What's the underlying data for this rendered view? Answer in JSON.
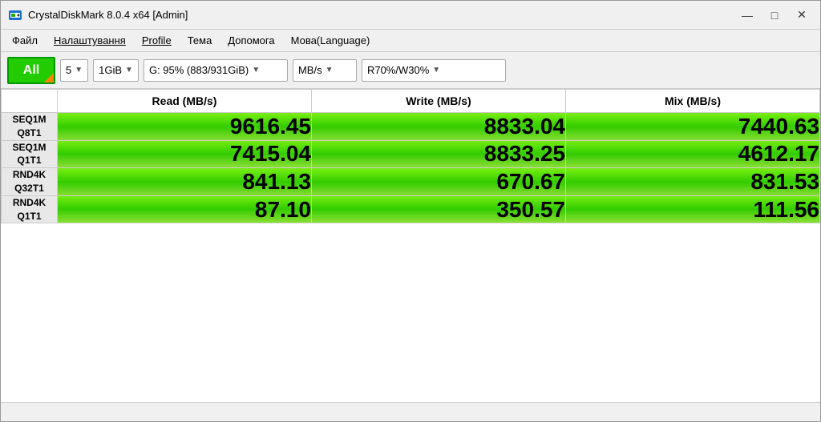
{
  "titlebar": {
    "title": "CrystalDiskMark 8.0.4 x64 [Admin]",
    "controls": {
      "minimize": "—",
      "maximize": "□",
      "close": "✕"
    }
  },
  "menubar": {
    "items": [
      {
        "id": "file",
        "label": "Файл",
        "underline": false
      },
      {
        "id": "settings",
        "label": "Налаштування",
        "underline": true
      },
      {
        "id": "profile",
        "label": "Profile",
        "underline": true
      },
      {
        "id": "theme",
        "label": "Тема",
        "underline": false
      },
      {
        "id": "help",
        "label": "Допомога",
        "underline": false
      },
      {
        "id": "language",
        "label": "Мова(Language)",
        "underline": false
      }
    ]
  },
  "toolbar": {
    "all_button": "All",
    "count_dropdown": "5",
    "size_dropdown": "1GiB",
    "drive_dropdown": "G: 95% (883/931GiB)",
    "unit_dropdown": "MB/s",
    "profile_dropdown": "R70%/W30%"
  },
  "table": {
    "headers": [
      "",
      "Read (MB/s)",
      "Write (MB/s)",
      "Mix (MB/s)"
    ],
    "rows": [
      {
        "label_line1": "SEQ1M",
        "label_line2": "Q8T1",
        "read": "9616.45",
        "write": "8833.04",
        "mix": "7440.63"
      },
      {
        "label_line1": "SEQ1M",
        "label_line2": "Q1T1",
        "read": "7415.04",
        "write": "8833.25",
        "mix": "4612.17"
      },
      {
        "label_line1": "RND4K",
        "label_line2": "Q32T1",
        "read": "841.13",
        "write": "670.67",
        "mix": "831.53"
      },
      {
        "label_line1": "RND4K",
        "label_line2": "Q1T1",
        "read": "87.10",
        "write": "350.57",
        "mix": "111.56"
      }
    ]
  }
}
